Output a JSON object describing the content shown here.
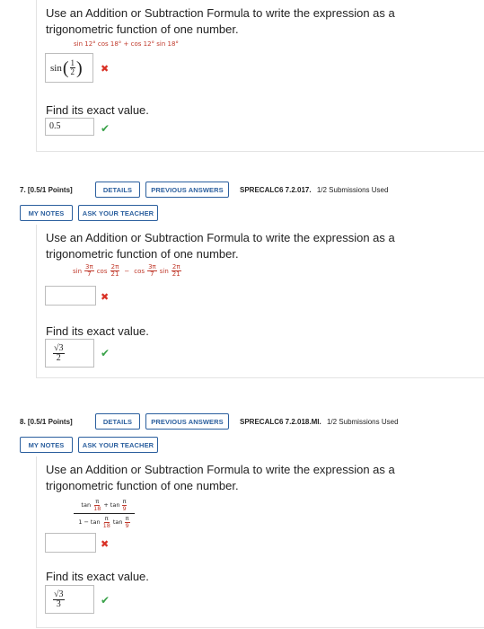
{
  "q6": {
    "prompt": "Use an Addition or Subtraction Formula to write the expression as a trigonometric function of one number.",
    "expression": "sin 12° cos 18° + cos 12° sin 18°",
    "answer_func": "sin",
    "answer_num": "1",
    "answer_den": "2",
    "find_exact": "Find its exact value.",
    "exact_answer": "0.5"
  },
  "q7": {
    "number": "7.",
    "points": "[0.5/1 Points]",
    "details_label": "DETAILS",
    "previous_label": "PREVIOUS ANSWERS",
    "code": "SPRECALC6 7.2.017.",
    "submissions": "1/2 Submissions Used",
    "notes_label": "MY NOTES",
    "ask_label": "ASK YOUR TEACHER",
    "prompt": "Use an Addition or Subtraction Formula to write the expression as a trigonometric function of one number.",
    "expr": {
      "sin1": "sin",
      "n1": "3π",
      "d1": "7",
      "cos1": "cos",
      "n2": "2π",
      "d2": "21",
      "minus": "−",
      "cos2": "cos",
      "n3": "3π",
      "d3": "7",
      "sin2": "sin",
      "n4": "2π",
      "d4": "21"
    },
    "answer": "",
    "find_exact": "Find its exact value.",
    "exact_num": "√3",
    "exact_den": "2"
  },
  "q8": {
    "number": "8.",
    "points": "[0.5/1 Points]",
    "details_label": "DETAILS",
    "previous_label": "PREVIOUS ANSWERS",
    "code": "SPRECALC6 7.2.018.MI.",
    "submissions": "1/2 Submissions Used",
    "notes_label": "MY NOTES",
    "ask_label": "ASK YOUR TEACHER",
    "prompt": "Use an Addition or Subtraction Formula to write the expression as a trigonometric function of one number.",
    "expr": {
      "tan1": "tan",
      "n1": "π",
      "d1": "18",
      "plus": "+",
      "tan2": "tan",
      "n2": "π",
      "d2": "9",
      "one": "1",
      "minus": "−",
      "tan3": "tan",
      "n3": "π",
      "d3": "18",
      "tan4": "tan",
      "n4": "π",
      "d4": "9"
    },
    "answer": "",
    "find_exact": "Find its exact value.",
    "exact_num": "√3",
    "exact_den": "3"
  },
  "colors": {
    "link_blue": "#2b5f9e",
    "error_red": "#d93025",
    "expr_red": "#c0392b",
    "ok_green": "#3aa24a"
  }
}
